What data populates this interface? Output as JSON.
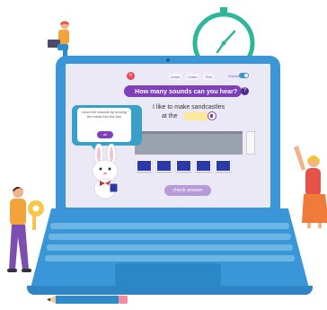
{
  "app": {
    "logo_letter": "b",
    "header_tabs": [
      "Learn",
      "Learn",
      "Test"
    ],
    "volume_label": "Volume"
  },
  "exercise": {
    "question": "How many sounds can you hear?",
    "help_symbol": "?",
    "sentence_line_1": "I like to make sandcastles",
    "sentence_line_2": "at the",
    "card_count": 5,
    "check_button": "check answer"
  },
  "instruction_bubble": {
    "text": "count the sounds by moving the cards into the box",
    "ok_label": "ok"
  },
  "colors": {
    "laptop": "#3a96d6",
    "screen_bg": "#ece9f6",
    "accent_purple": "#7e3fb8",
    "card_blue": "#2b3aa8",
    "blank_yellow": "#fde79a",
    "bubble_blue": "#3aa0c8"
  },
  "icons": [
    "clock-icon",
    "speaker-icon",
    "help-icon",
    "bunny-mascot"
  ]
}
